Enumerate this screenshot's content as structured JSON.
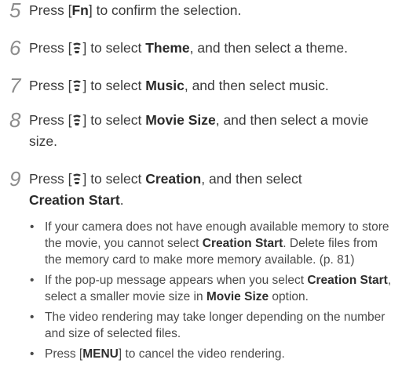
{
  "steps": [
    {
      "num": "5",
      "pre": "Press [",
      "key": "Fn",
      "post": "] to confirm the selection."
    },
    {
      "num": "6",
      "pre": "Press [",
      "post": "] to select ",
      "bold": "Theme",
      "tail": ", and then select a theme."
    },
    {
      "num": "7",
      "pre": "Press [",
      "post": "] to select ",
      "bold": "Music",
      "tail": ", and then select music."
    },
    {
      "num": "8",
      "pre": "Press [",
      "post": "] to select ",
      "bold": "Movie Size",
      "tail": ", and then select a movie size."
    },
    {
      "num": "9",
      "pre": "Press [",
      "post": "] to select ",
      "bold": "Creation",
      "tail": ", and then select",
      "bold2": "Creation Start",
      "tail2": "."
    }
  ],
  "bullets": [
    {
      "t1": "If your camera does not have enough available memory to store the movie, you cannot select ",
      "b1": "Creation Start",
      "t2": ". Delete files from the memory card to make more memory available. (p. 81)"
    },
    {
      "t1": "If the pop-up message appears when you select ",
      "b1": "Creation Start",
      "t2": ", select a smaller movie size in ",
      "b2": "Movie Size",
      "t3": " option."
    },
    {
      "t1": "The video rendering may take longer depending on the number and size of selected files."
    },
    {
      "t1": "Press [",
      "b1": "MENU",
      "t2": "] to cancel the video rendering."
    }
  ],
  "icons": {
    "step_icon": "macro-dial-icon"
  }
}
